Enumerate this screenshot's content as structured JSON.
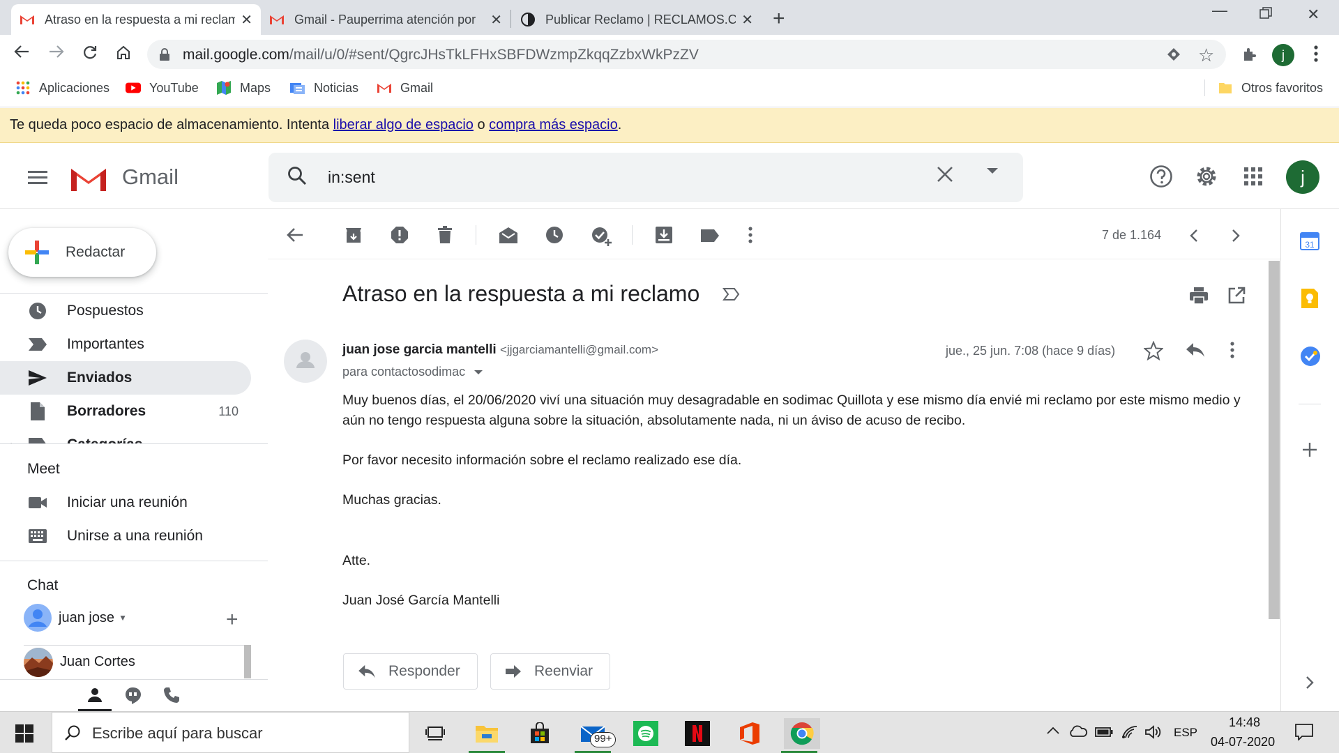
{
  "browser": {
    "tabs": [
      {
        "title": "Atraso en la respuesta a mi reclamo",
        "active": true
      },
      {
        "title": "Gmail - Pauperrima atención por",
        "active": false
      },
      {
        "title": "Publicar Reclamo | RECLAMOS.CL",
        "active": false
      }
    ],
    "new_tab": "+",
    "url_host": "mail.google.com",
    "url_path": "/mail/u/0/#sent/QgrcJHsTkLFHxSBFDWzmpZkqqZzbxWkPzZV",
    "profile_initial": "j",
    "bookmarks": [
      {
        "label": "Aplicaciones",
        "icon": "apps-grid-icon"
      },
      {
        "label": "YouTube",
        "icon": "youtube-icon"
      },
      {
        "label": "Maps",
        "icon": "maps-icon"
      },
      {
        "label": "Noticias",
        "icon": "news-icon"
      },
      {
        "label": "Gmail",
        "icon": "gmail-icon"
      }
    ],
    "other_bookmarks": "Otros favoritos"
  },
  "banner": {
    "prefix": "Te queda poco espacio de almacenamiento. Intenta ",
    "link1": "liberar algo de espacio",
    "middle": " o ",
    "link2": "compra más espacio",
    "suffix": "."
  },
  "gmail": {
    "brand": "Gmail",
    "search_query": "in:sent",
    "avatar_initial": "j",
    "compose_label": "Redactar",
    "nav": [
      {
        "label": "Pospuestos",
        "icon": "clock-icon"
      },
      {
        "label": "Importantes",
        "icon": "important-icon"
      },
      {
        "label": "Enviados",
        "icon": "send-icon",
        "active": true
      },
      {
        "label": "Borradores",
        "icon": "draft-icon",
        "count": "110"
      },
      {
        "label": "Categorías",
        "icon": "label-icon"
      }
    ],
    "meet": {
      "title": "Meet",
      "start": "Iniciar una reunión",
      "join": "Unirse a una reunión"
    },
    "chat": {
      "title": "Chat",
      "user": "juan jose",
      "contact": "Juan Cortes"
    },
    "pager": "7 de 1.164",
    "message": {
      "subject": "Atraso en la respuesta a mi reclamo",
      "sender_name": "juan jose garcia mantelli",
      "sender_email": "<jjgarciamantelli@gmail.com>",
      "to": "para contactosodimac",
      "date": "jue., 25 jun. 7:08 (hace 9 días)",
      "body": [
        "Muy buenos días, el 20/06/2020 viví una situación muy desagradable en sodimac Quillota y ese mismo día envié mi reclamo por este mismo medio y aún no tengo respuesta alguna sobre la situación, absolutamente nada, ni un áviso de acuso de recibo.",
        "Por favor necesito información sobre el reclamo realizado ese día.",
        "Muchas gracias.",
        "Atte.",
        "Juan José García Mantelli"
      ]
    },
    "actions": {
      "reply": "Responder",
      "forward": "Reenviar"
    }
  },
  "taskbar": {
    "search_placeholder": "Escribe aquí para buscar",
    "mail_badge": "99+",
    "language": "ESP",
    "time": "14:48",
    "date": "04-07-2020"
  },
  "colors": {
    "gmail_red": "#ea4335",
    "banner_bg": "#fcefc4",
    "avatar_green": "#1e6b34"
  }
}
